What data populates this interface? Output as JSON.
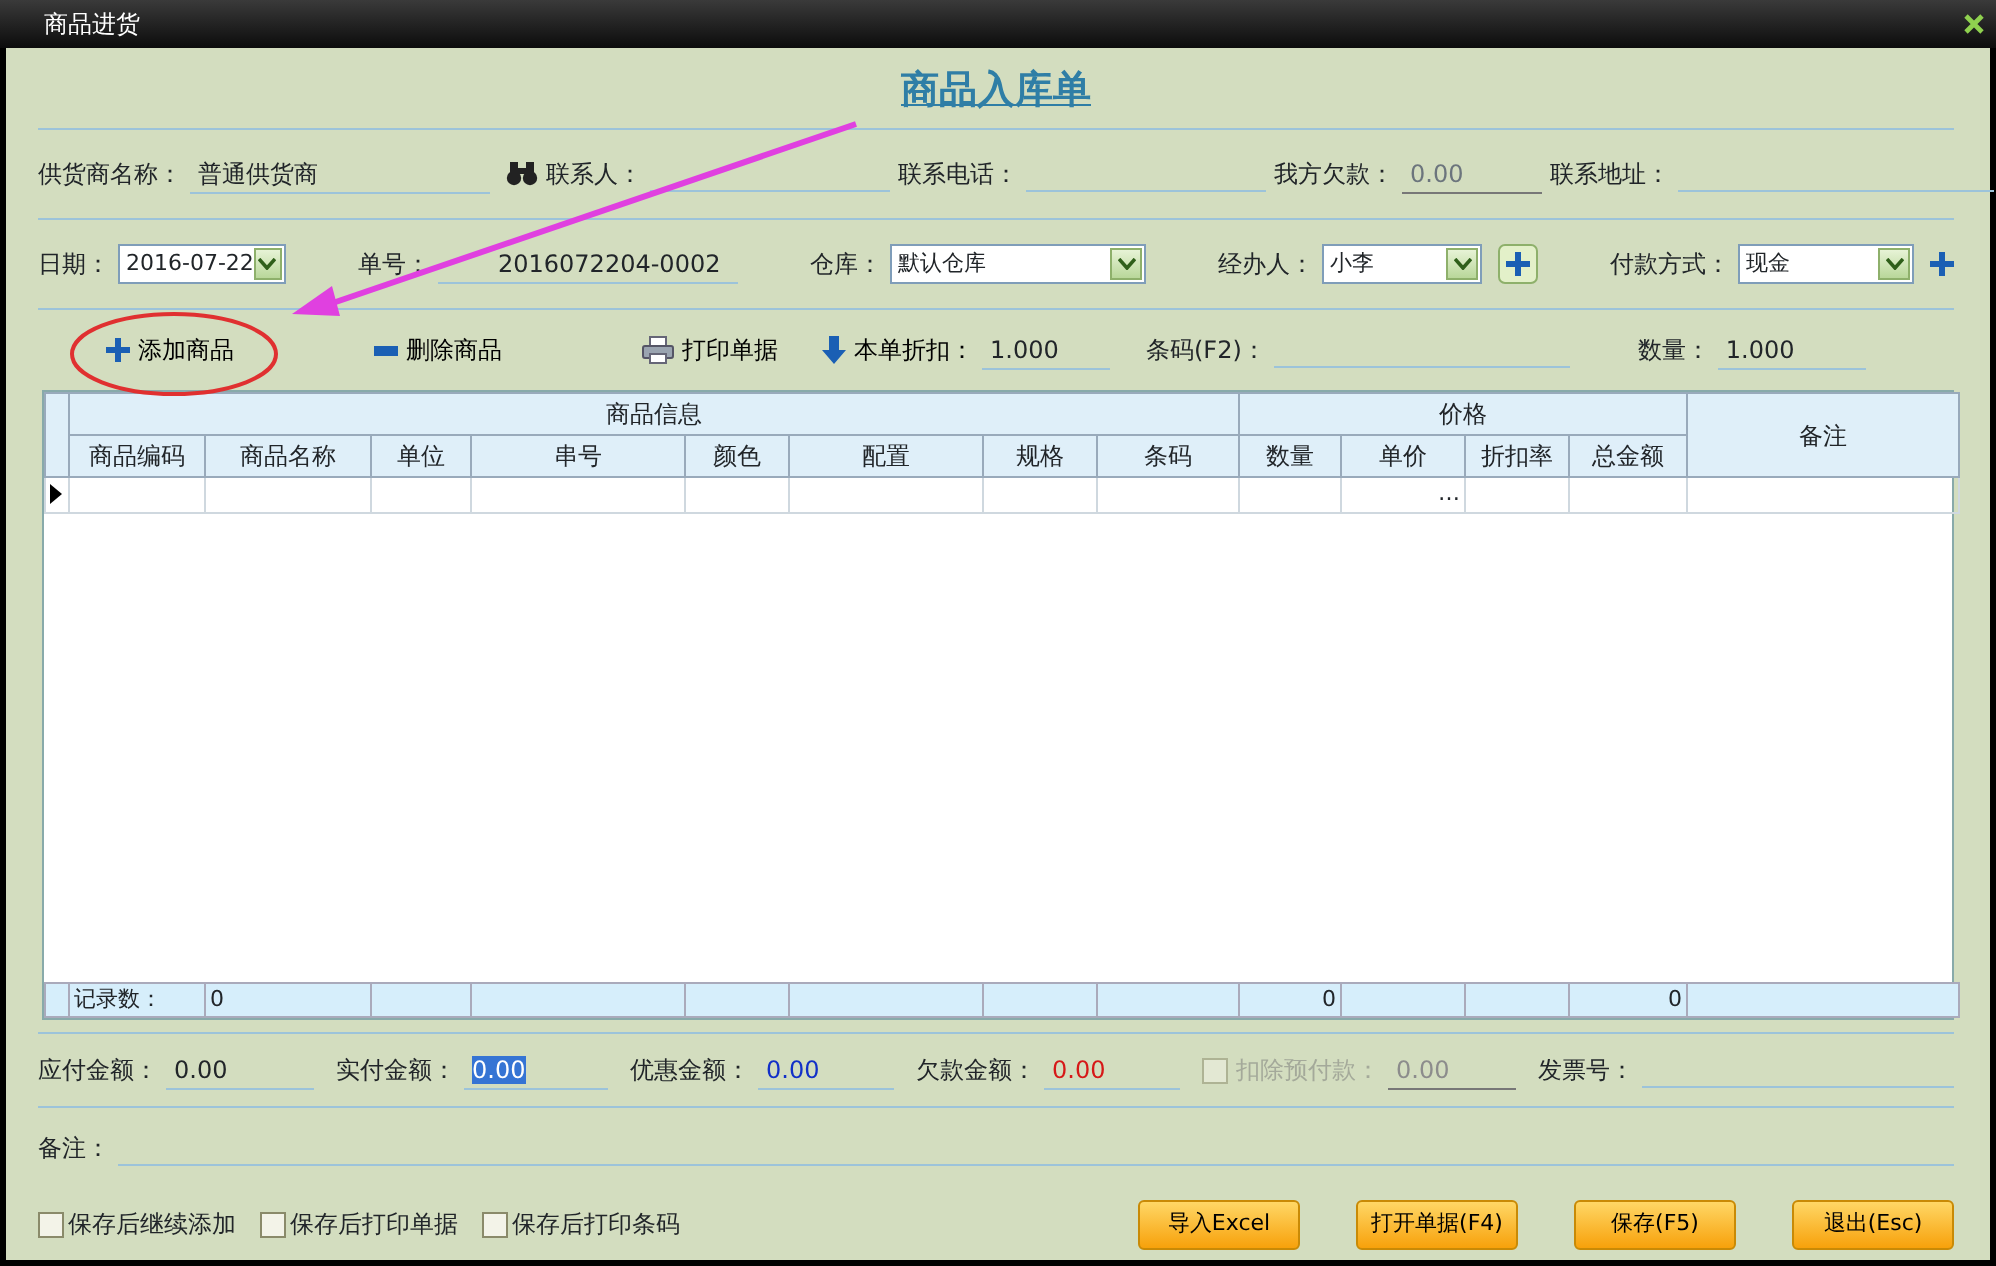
{
  "window": {
    "title": "商品进货"
  },
  "form_title": "商品入库单",
  "header_rows": [
    [
      {
        "label": "供货商名称：",
        "value": "普通供货商",
        "kind": "text"
      },
      {
        "label": "联系人：",
        "kind": "text"
      },
      {
        "label": "联系电话：",
        "kind": "text"
      },
      {
        "label": "我方欠款：",
        "value": "0.00",
        "kind": "readonly"
      },
      {
        "label": "联系地址：",
        "kind": "text"
      }
    ],
    [
      {
        "label": "日期：",
        "value": "2016-07-22",
        "kind": "select"
      },
      {
        "label": "单号：",
        "value": "2016072204-0002",
        "kind": "text"
      },
      {
        "label": "仓库：",
        "value": "默认仓库",
        "kind": "select"
      },
      {
        "label": "经办人：",
        "value": "小李",
        "kind": "select"
      },
      {
        "label": "付款方式：",
        "value": "现金",
        "kind": "select"
      }
    ]
  ],
  "toolbar": {
    "actions": [
      {
        "label": "添加商品"
      },
      {
        "label": "删除商品"
      },
      {
        "label": "打印单据"
      },
      {
        "label": "本单折扣："
      }
    ],
    "fields": [
      {
        "label": "条码(F2)："
      },
      {
        "label": "数量：",
        "value": "1.000"
      }
    ],
    "discount": "1.000"
  },
  "table": {
    "groups": [
      "商品信息",
      "价格"
    ],
    "columns": [
      "商品编码",
      "商品名称",
      "单位",
      "串号",
      "颜色",
      "配置",
      "规格",
      "条码",
      "数量",
      "单价",
      "折扣率",
      "总金额"
    ],
    "remark_column": "备注",
    "rows": [
      {
        "current": true,
        "cells": [
          "",
          "",
          "",
          "",
          "",
          "",
          "",
          "",
          "",
          "…",
          "",
          ""
        ]
      }
    ],
    "footer": {
      "label": "记录数：",
      "cells": [
        "0",
        "",
        "",
        "",
        "",
        "",
        "",
        "0",
        "",
        "",
        "0"
      ]
    }
  },
  "totals": [
    {
      "label": "应付金额：",
      "value": "0.00",
      "kind": "plain"
    },
    {
      "label": "实付金额：",
      "value": "0.00",
      "kind": "selected"
    },
    {
      "label": "优惠金额：",
      "value": "0.00",
      "kind": "blue"
    },
    {
      "label": "欠款金额：",
      "value": "0.00",
      "kind": "red"
    },
    {
      "label": "扣除预付款：",
      "value": "0.00",
      "kind": "checkbox",
      "checked": false,
      "disabled": true
    },
    {
      "label": "发票号：",
      "kind": "plain"
    }
  ],
  "notes": {
    "label": "备注："
  },
  "options": [
    {
      "label": "保存后继续添加",
      "checked": false
    },
    {
      "label": "保存后打印单据",
      "checked": false
    },
    {
      "label": "保存后打印条码",
      "checked": false
    }
  ],
  "buttons": [
    "导入Excel",
    "打开单据(F4)",
    "保存(F5)",
    "退出(Esc)"
  ]
}
